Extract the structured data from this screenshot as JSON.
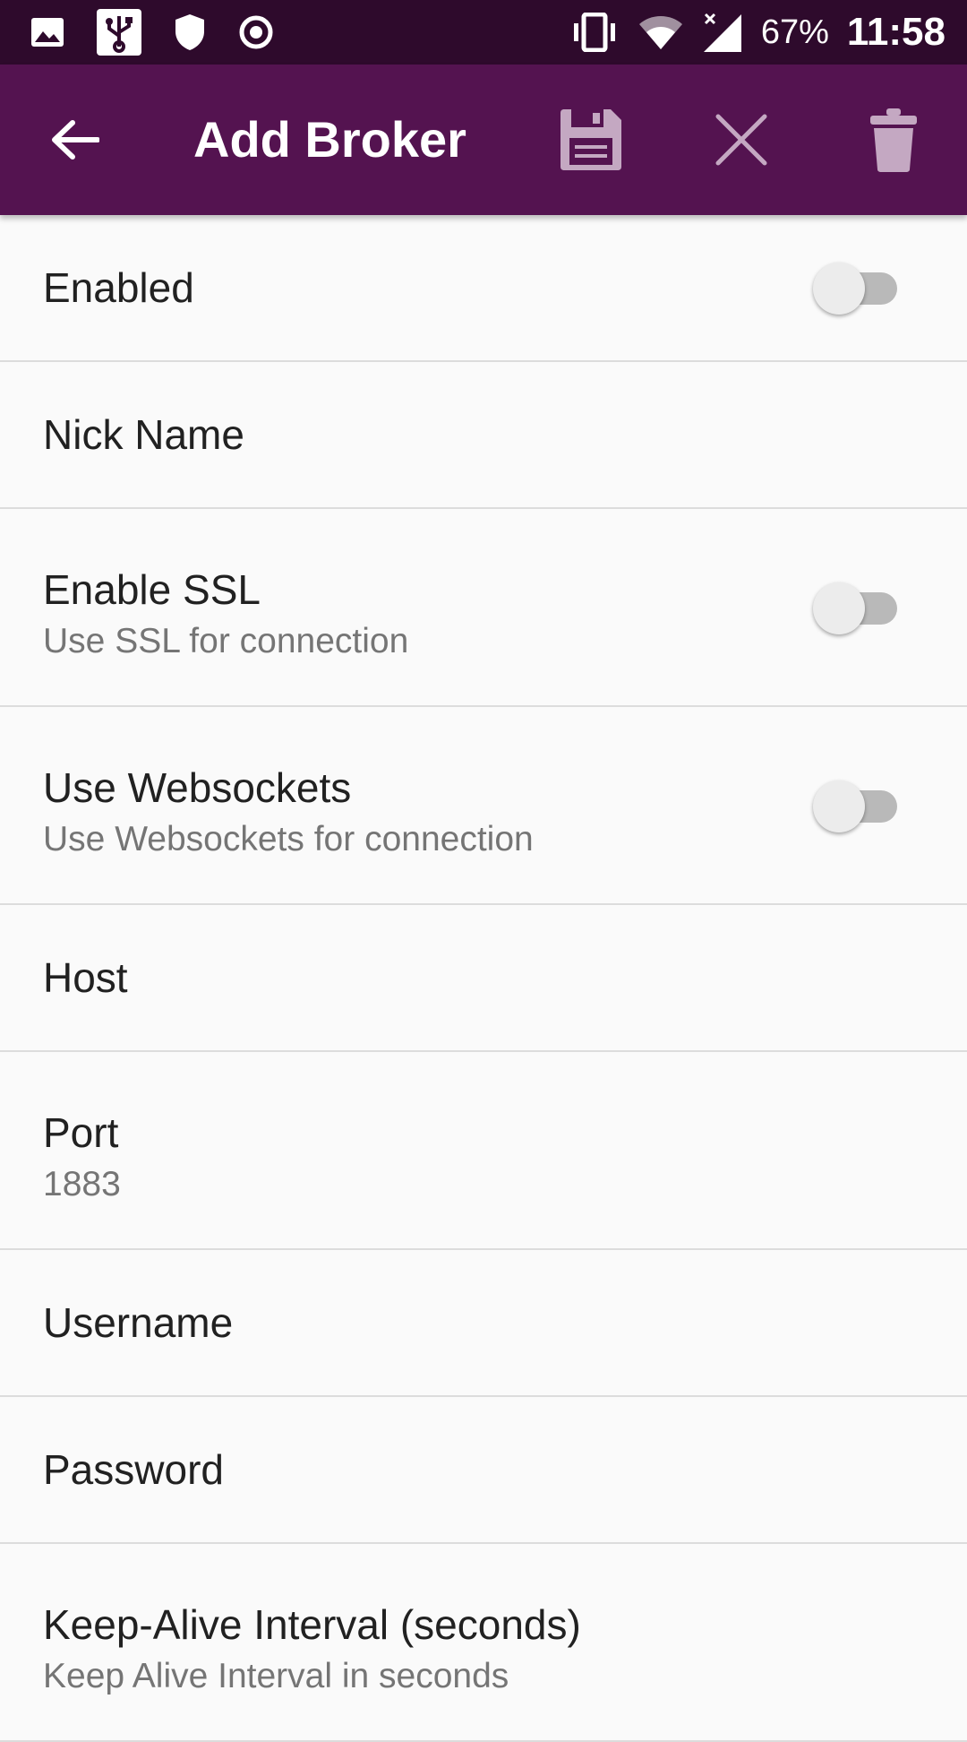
{
  "status_bar": {
    "icons_left": [
      "image-icon",
      "usb-icon",
      "shield-icon",
      "record-icon"
    ],
    "icons_right": [
      "vibrate-icon",
      "wifi-icon",
      "signal-icon"
    ],
    "battery": "67%",
    "time": "11:58"
  },
  "toolbar": {
    "title": "Add Broker",
    "icons": [
      "back-arrow-icon",
      "save-icon",
      "close-icon",
      "delete-icon"
    ]
  },
  "settings": [
    {
      "title": "Enabled",
      "summary": "",
      "switch": false
    },
    {
      "title": "Nick Name",
      "summary": ""
    },
    {
      "title": "Enable SSL",
      "summary": "Use SSL for connection",
      "switch": false
    },
    {
      "title": "Use Websockets",
      "summary": "Use Websockets for connection",
      "switch": false
    },
    {
      "title": "Host",
      "summary": ""
    },
    {
      "title": "Port",
      "summary": "1883"
    },
    {
      "title": "Username",
      "summary": ""
    },
    {
      "title": "Password",
      "summary": ""
    },
    {
      "title": "Keep-Alive Interval (seconds)",
      "summary": "Keep Alive Interval in seconds"
    }
  ],
  "colors": {
    "status_bar": "#2e0a2c",
    "toolbar": "#541350",
    "toolbar_icon": "#c4a8c2",
    "background": "#fafafa"
  }
}
